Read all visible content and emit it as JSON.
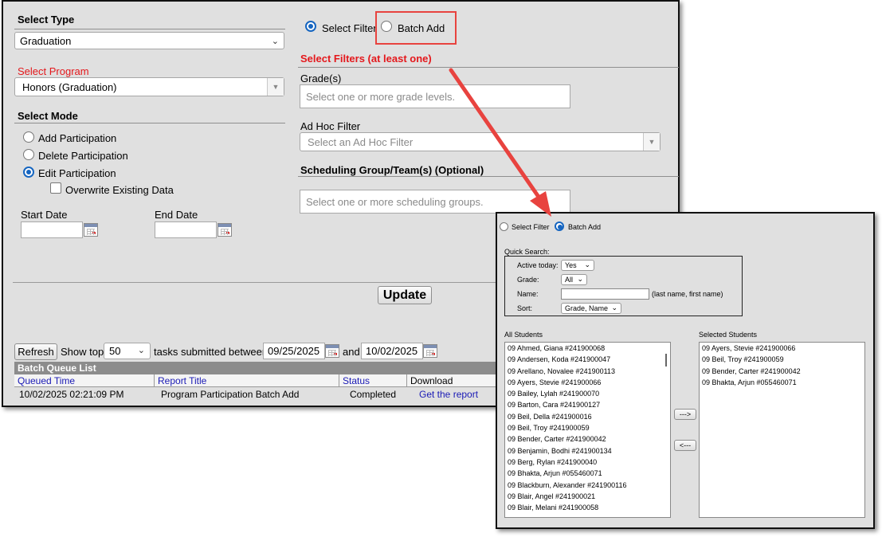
{
  "select_type": {
    "heading": "Select Type",
    "value": "Graduation"
  },
  "select_program": {
    "heading": "Select Program",
    "value": "Honors (Graduation)"
  },
  "select_mode": {
    "heading": "Select Mode",
    "options": [
      "Add Participation",
      "Delete Participation",
      "Edit Participation"
    ],
    "selected": "Edit Participation",
    "overwrite_label": "Overwrite Existing Data"
  },
  "dates": {
    "start_label": "Start Date",
    "end_label": "End Date",
    "start_value": "",
    "end_value": ""
  },
  "filter_mode": {
    "select_filter": "Select Filter",
    "batch_add": "Batch Add",
    "selected": "Select Filter"
  },
  "filters": {
    "heading": "Select Filters (at least one)",
    "grades_label": "Grade(s)",
    "grades_placeholder": "Select one or more grade levels.",
    "adhoc_label": "Ad Hoc Filter",
    "adhoc_placeholder": "Select an Ad Hoc Filter",
    "sched_label": "Scheduling Group/Team(s) (Optional)",
    "sched_placeholder": "Select one or more scheduling groups."
  },
  "update_label": "Update",
  "batch_queue": {
    "refresh_label": "Refresh",
    "show_top_label": "Show top",
    "show_top_value": "50",
    "between_label": "tasks submitted between",
    "date_from": "09/25/2025",
    "and_label": "and",
    "date_to": "10/02/2025",
    "title": "Batch Queue List",
    "columns": [
      "Queued Time",
      "Report Title",
      "Status",
      "Download"
    ],
    "rows": [
      {
        "queued_time": "10/02/2025 02:21:09 PM",
        "report_title": "Program Participation Batch Add",
        "status": "Completed",
        "download": "Get the report"
      }
    ]
  },
  "zoom_panel": {
    "select_filter": "Select Filter",
    "batch_add": "Batch Add",
    "selected": "Batch Add",
    "quick_search_label": "Quick Search:",
    "active_today_label": "Active today:",
    "active_today_value": "Yes",
    "grade_label": "Grade:",
    "grade_value": "All",
    "name_label": "Name:",
    "name_value": "",
    "name_hint": "(last name, first name)",
    "sort_label": "Sort:",
    "sort_value": "Grade, Name",
    "all_students_label": "All Students",
    "selected_students_label": "Selected Students",
    "add_arrow": "--->",
    "remove_arrow": "<---",
    "all_students": [
      "09 Ahmed, Giana  #241900068",
      "09 Andersen, Koda  #241900047",
      "09 Arellano, Novalee  #241900113",
      "09 Ayers, Stevie  #241900066",
      "09 Bailey, Lylah  #241900070",
      "09 Barton, Cara  #241900127",
      "09 Beil, Della  #241900016",
      "09 Beil, Troy  #241900059",
      "09 Bender, Carter  #241900042",
      "09 Benjamin, Bodhi  #241900134",
      "09 Berg, Rylan  #241900040",
      "09 Bhakta, Arjun  #055460071",
      "09 Blackburn, Alexander  #241900116",
      "09 Blair, Angel  #241900021",
      "09 Blair, Melani  #241900058"
    ],
    "selected_students": [
      "09 Ayers, Stevie  #241900066",
      "09 Beil, Troy  #241900059",
      "09 Bender, Carter  #241900042",
      "09 Bhakta, Arjun  #055460071"
    ]
  },
  "colors": {
    "highlight": "#e8433f",
    "accent_blue": "#1565c0",
    "required_red": "#e4181c",
    "link_blue": "#1a1ab5"
  }
}
